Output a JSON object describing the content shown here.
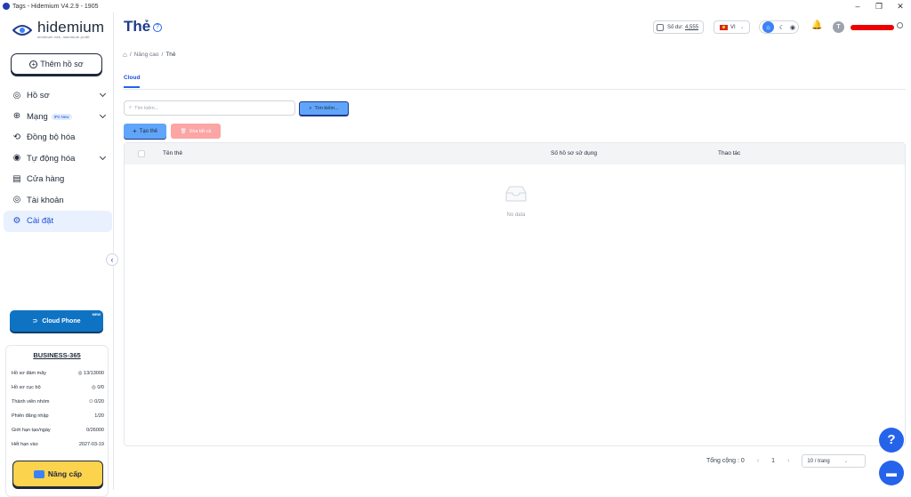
{
  "window": {
    "title": "Tags - Hidemium V4.2.9 - 1905"
  },
  "brand": {
    "name": "hidemium",
    "tagline": "minimum risk, maximum profit"
  },
  "sidebar": {
    "add_profile": "Thêm hồ sơ",
    "items": [
      {
        "label": "Hồ sơ",
        "icon": "profile-icon",
        "has_chevron": true
      },
      {
        "label": "Mạng",
        "icon": "network-icon",
        "badge": "IPs New",
        "has_chevron": true
      },
      {
        "label": "Đồng bộ hóa",
        "icon": "sync-icon"
      },
      {
        "label": "Tự động hóa",
        "icon": "automation-icon",
        "has_chevron": true
      },
      {
        "label": "Cửa hàng",
        "icon": "store-icon"
      },
      {
        "label": "Tài khoản",
        "icon": "account-icon"
      },
      {
        "label": "Cài đặt",
        "icon": "settings-icon",
        "active": true
      }
    ],
    "cloud_phone": {
      "label": "Cloud Phone",
      "badge": "NEW"
    },
    "plan": {
      "name": "BUSINESS-365",
      "rows": [
        {
          "label": "Hồ sơ đám mây",
          "value": "13/13000"
        },
        {
          "label": "Hồ sơ cục bộ",
          "value": "0/0"
        },
        {
          "label": "Thành viên nhóm",
          "value": "0/20"
        },
        {
          "label": "Phiên đăng nhập",
          "value": "1/20"
        },
        {
          "label": "Giới hạn tạo/ngày",
          "value": "0/26000"
        },
        {
          "label": "Hết hạn vào",
          "value": "2027-03-19"
        }
      ],
      "upgrade": "Nâng cấp"
    }
  },
  "header": {
    "title": "Thẻ",
    "balance_label": "Số dư:",
    "balance_value": "4,555",
    "language": "VI",
    "avatar_letter": "T"
  },
  "breadcrumb": {
    "parent": "Nâng cao",
    "separator": "/",
    "current": "Thẻ"
  },
  "tabs": [
    {
      "label": "Cloud",
      "active": true
    }
  ],
  "search": {
    "placeholder": "Tìm kiếm...",
    "button": "Tìm kiếm..."
  },
  "actions": {
    "create": "Tạo thẻ",
    "delete_all": "Xóa tất cả"
  },
  "table": {
    "columns": [
      "Tên thẻ",
      "Số hồ sơ sử dụng",
      "Thao tác"
    ],
    "rows": [],
    "empty_text": "No data"
  },
  "pagination": {
    "total": "Tổng cộng : 0",
    "page": "1",
    "page_size": "10 / trang"
  },
  "colors": {
    "accent": "#2563eb",
    "brand_dark": "#1e3a8a",
    "upgrade": "#fcd34d",
    "danger_light": "#fca5a5"
  }
}
